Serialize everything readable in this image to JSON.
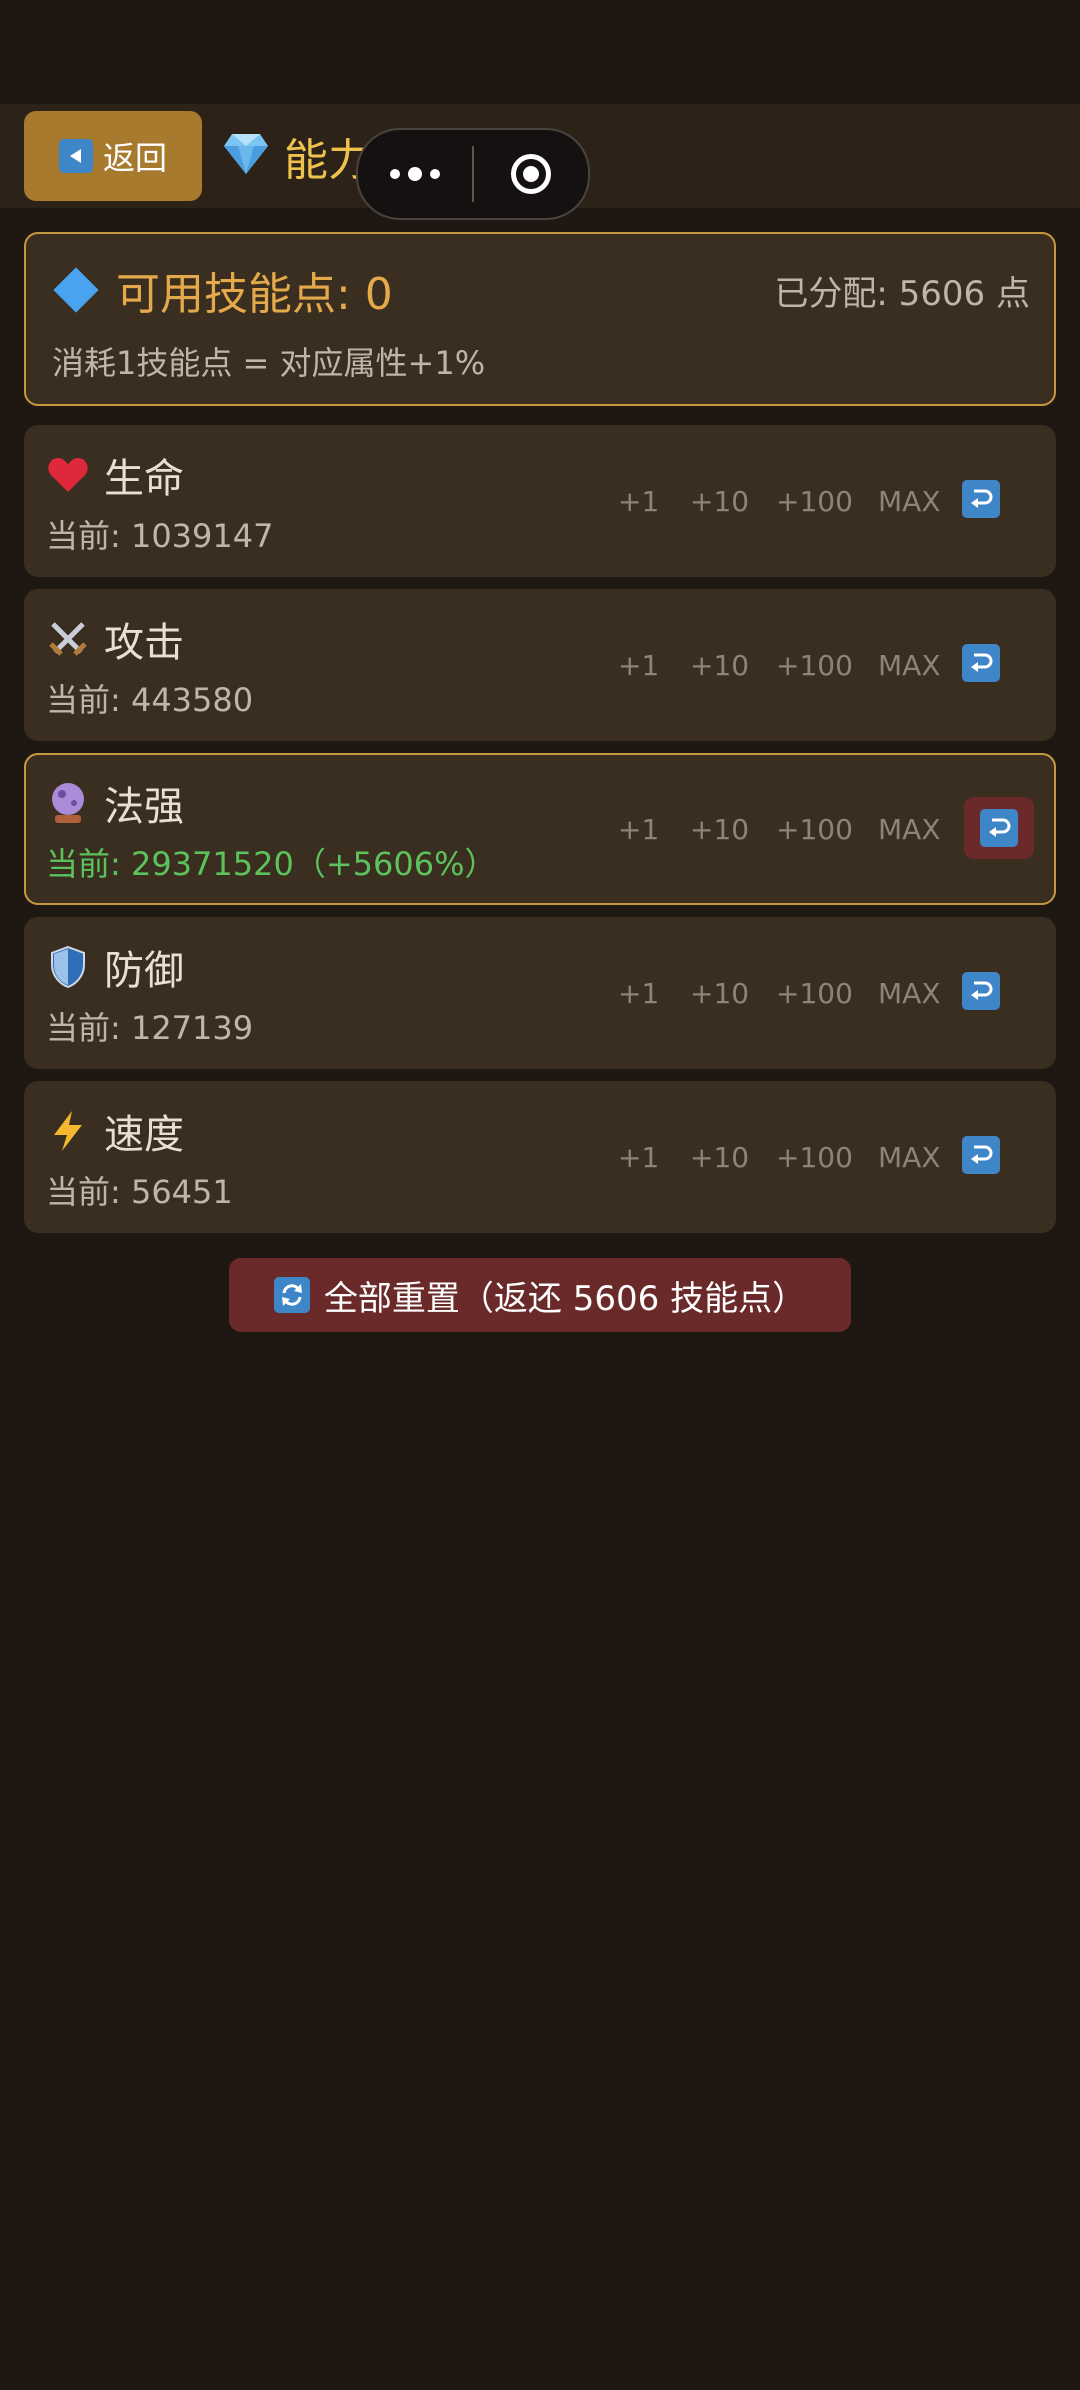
{
  "header": {
    "back_label": "返回",
    "title": "能力点"
  },
  "points": {
    "available": "可用技能点: 0",
    "allocated": "已分配: 5606 点",
    "rule": "消耗1技能点 = 对应属性+1%"
  },
  "buttons": {
    "plus1": "+1",
    "plus10": "+10",
    "plus100": "+100",
    "max": "MAX"
  },
  "stats": [
    {
      "name": "生命",
      "current": "当前: 1039147",
      "icon": "heart-icon"
    },
    {
      "name": "攻击",
      "current": "当前: 443580",
      "icon": "swords-icon"
    },
    {
      "name": "法强",
      "current": "当前: 29371520（+5606%）",
      "icon": "crystal-ball-icon"
    },
    {
      "name": "防御",
      "current": "当前: 127139",
      "icon": "shield-icon"
    },
    {
      "name": "速度",
      "current": "当前: 56451",
      "icon": "lightning-icon"
    }
  ],
  "reset_all_label": "全部重置（返还 5606 技能点）",
  "colors": {
    "background": "#1e1712",
    "card": "#3a2e20",
    "gold_border": "#c7993f",
    "accent_gold": "#e3a94a",
    "green": "#5cc25c",
    "reset_red": "#6b2a2a",
    "icon_blue": "#3f86c9"
  }
}
